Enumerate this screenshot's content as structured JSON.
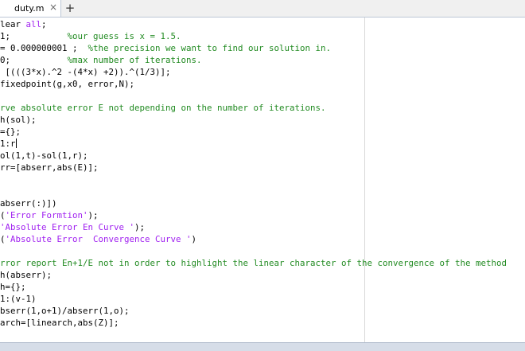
{
  "tabs": [
    {
      "label": "duty.m",
      "close": "×"
    }
  ],
  "add_tab": "+",
  "code": {
    "lines": [
      [
        {
          "t": "lear "
        },
        {
          "t": "all",
          "cls": "s"
        },
        {
          "t": ";"
        }
      ],
      [
        {
          "t": "1;           "
        },
        {
          "t": "%our guess is x = 1.5.",
          "cls": "c"
        }
      ],
      [
        {
          "t": "= 0.000000001 ;  "
        },
        {
          "t": "%the precision we want to find our solution in.",
          "cls": "c"
        }
      ],
      [
        {
          "t": "0;           "
        },
        {
          "t": "%max number of iterations.",
          "cls": "c"
        }
      ],
      [
        {
          "t": " [(((3*x).^2 -(4*x) +2)).^(1/3)];"
        }
      ],
      [
        {
          "t": "fixedpoint(g,x0, error,N);"
        }
      ],
      [
        {
          "t": ""
        }
      ],
      [
        {
          "t": "rve absolute error E not depending on the number of iterations.",
          "cls": "c"
        }
      ],
      [
        {
          "t": "h(sol);"
        }
      ],
      [
        {
          "t": "={};"
        }
      ],
      [
        {
          "t": "1:r"
        },
        {
          "cursor": true
        }
      ],
      [
        {
          "t": "ol(1,t)-sol(1,r);"
        }
      ],
      [
        {
          "t": "rr=[abserr,abs(E)];"
        }
      ],
      [
        {
          "t": ""
        }
      ],
      [
        {
          "t": ""
        }
      ],
      [
        {
          "t": "abserr(:)])"
        }
      ],
      [
        {
          "t": "("
        },
        {
          "t": "'Error Formtion'",
          "cls": "s"
        },
        {
          "t": ");"
        }
      ],
      [
        {
          "t": "'Absolute Error En Curve '",
          "cls": "s"
        },
        {
          "t": ");"
        }
      ],
      [
        {
          "t": "("
        },
        {
          "t": "'Absolute Error  Convergence Curve '",
          "cls": "s"
        },
        {
          "t": ")"
        }
      ],
      [
        {
          "t": ""
        }
      ],
      [
        {
          "t": "rror report En+1/E not in order to highlight the linear character of the convergence of the method",
          "cls": "c"
        }
      ],
      [
        {
          "t": "h(abserr);"
        }
      ],
      [
        {
          "t": "h={};"
        }
      ],
      [
        {
          "t": "1:(v-1)"
        }
      ],
      [
        {
          "t": "bserr(1,o+1)/abserr(1,o);"
        }
      ],
      [
        {
          "t": "arch=[linearch,abs(Z)];"
        }
      ]
    ]
  }
}
